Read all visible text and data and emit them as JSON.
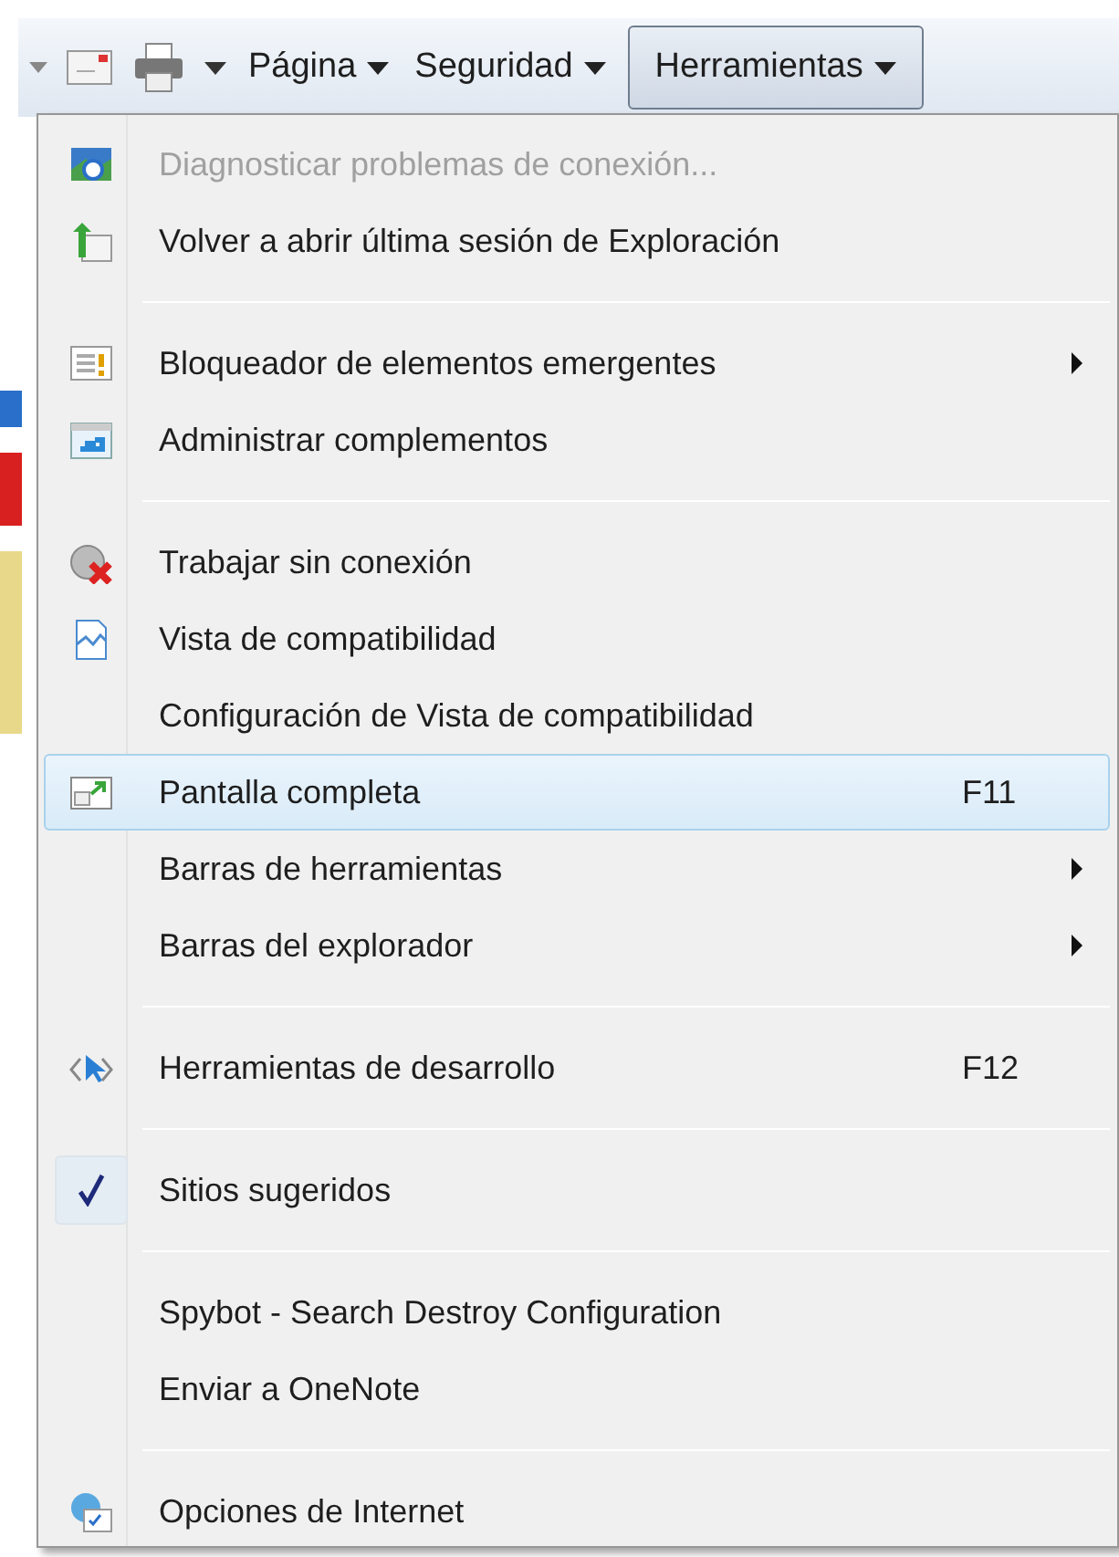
{
  "toolbar": {
    "buttons": [
      {
        "label": "Página",
        "selected": false
      },
      {
        "label": "Seguridad",
        "selected": false
      },
      {
        "label": "Herramientas",
        "selected": true
      }
    ]
  },
  "menu": {
    "items": [
      {
        "kind": "item",
        "label": "Diagnosticar problemas de conexión...",
        "disabled": true,
        "selected": false
      },
      {
        "kind": "item",
        "label": "Volver a abrir última sesión de Exploración",
        "disabled": false,
        "selected": false
      },
      {
        "kind": "separator"
      },
      {
        "kind": "item",
        "label": "Bloqueador de elementos emergentes",
        "disabled": false,
        "selected": false,
        "submenu": true
      },
      {
        "kind": "item",
        "label": "Administrar complementos",
        "disabled": false,
        "selected": false
      },
      {
        "kind": "separator"
      },
      {
        "kind": "item",
        "label": "Trabajar sin conexión",
        "disabled": false,
        "selected": false
      },
      {
        "kind": "item",
        "label": "Vista de compatibilidad",
        "disabled": false,
        "selected": false
      },
      {
        "kind": "item",
        "label": "Configuración de Vista de compatibilidad",
        "disabled": false,
        "selected": false
      },
      {
        "kind": "item",
        "label": "Pantalla completa",
        "disabled": false,
        "selected": true,
        "shortcut": "F11"
      },
      {
        "kind": "item",
        "label": "Barras de herramientas",
        "disabled": false,
        "selected": false,
        "submenu": true
      },
      {
        "kind": "item",
        "label": "Barras del explorador",
        "disabled": false,
        "selected": false,
        "submenu": true
      },
      {
        "kind": "separator"
      },
      {
        "kind": "item",
        "label": "Herramientas de desarrollo",
        "disabled": false,
        "selected": false,
        "shortcut": "F12"
      },
      {
        "kind": "separator"
      },
      {
        "kind": "item",
        "label": "Sitios sugeridos",
        "disabled": false,
        "selected": false,
        "checked": true
      },
      {
        "kind": "separator"
      },
      {
        "kind": "item",
        "label": "Spybot - Search  Destroy Configuration",
        "disabled": false,
        "selected": false
      },
      {
        "kind": "item",
        "label": "Enviar a OneNote",
        "disabled": false,
        "selected": false
      },
      {
        "kind": "separator"
      },
      {
        "kind": "item",
        "label": "Opciones de Internet",
        "disabled": false,
        "selected": false
      }
    ]
  }
}
